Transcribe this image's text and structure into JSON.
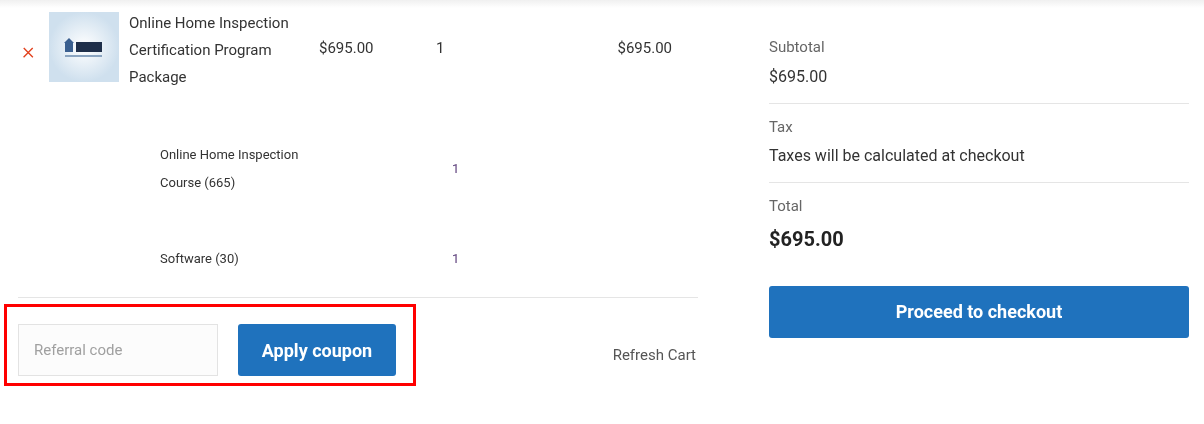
{
  "cart": {
    "item": {
      "name": "Online Home Inspection Certification Program Package",
      "price": "$695.00",
      "quantity": "1",
      "subtotal": "$695.00",
      "remove_icon": "×"
    },
    "sub_items": [
      {
        "name": "Online Home Inspection Course (665)",
        "quantity": "1"
      },
      {
        "name": "Software (30)",
        "quantity": "1"
      }
    ],
    "coupon": {
      "placeholder": "Referral code",
      "button": "Apply coupon",
      "highlighted": true
    },
    "refresh": "Refresh Cart"
  },
  "totals": {
    "rows": [
      {
        "label": "Subtotal",
        "value": "$695.00",
        "kind": "plain"
      },
      {
        "label": "Tax",
        "value": "Taxes will be calculated at checkout",
        "kind": "plain"
      },
      {
        "label": "Total",
        "value": "$695.00",
        "kind": "strong"
      }
    ],
    "checkout": "Proceed to checkout"
  }
}
